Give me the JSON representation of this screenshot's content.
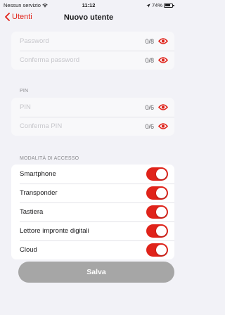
{
  "status_bar": {
    "carrier": "Nessun servizio",
    "time": "11:12",
    "battery": "74%",
    "wifi_icon": "wifi-icon",
    "battery_icon": "battery-icon"
  },
  "nav": {
    "back_label": "Utenti",
    "title": "Nuovo utente"
  },
  "password_section": {
    "fields": [
      {
        "placeholder": "Password",
        "counter": "0/8",
        "icon": "eye-icon"
      },
      {
        "placeholder": "Conferma password",
        "counter": "0/8",
        "icon": "eye-icon"
      }
    ]
  },
  "pin_section": {
    "header": "PIN",
    "fields": [
      {
        "placeholder": "PIN",
        "counter": "0/6",
        "icon": "eye-icon"
      },
      {
        "placeholder": "Conferma PIN",
        "counter": "0/6",
        "icon": "eye-icon"
      }
    ]
  },
  "access_section": {
    "header": "MODALITÀ DI ACCESSO",
    "items": [
      {
        "label": "Smartphone",
        "enabled": true
      },
      {
        "label": "Transponder",
        "enabled": true
      },
      {
        "label": "Tastiera",
        "enabled": true
      },
      {
        "label": "Lettore impronte digitali",
        "enabled": true
      },
      {
        "label": "Cloud",
        "enabled": true
      }
    ]
  },
  "save_button": {
    "label": "Salva"
  },
  "colors": {
    "accent": "#e0231a",
    "background": "#f2f2f7",
    "disabled_button": "#a6a6a6"
  }
}
